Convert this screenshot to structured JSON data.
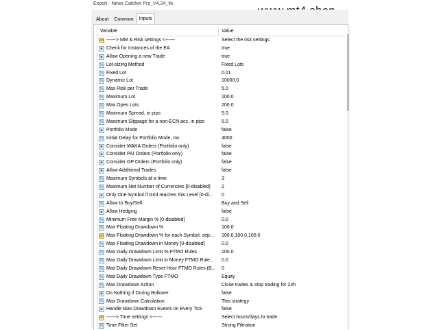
{
  "window": {
    "title": "Expert - News Catcher Pro_V4.24_fix"
  },
  "watermark": "www.mt4.shop",
  "tabs": [
    {
      "label": "About",
      "active": false
    },
    {
      "label": "Common",
      "active": false
    },
    {
      "label": "Inputs",
      "active": true
    }
  ],
  "grid": {
    "headers": {
      "variable": "Variable",
      "value": "Value"
    },
    "rows": [
      {
        "icon": "ab",
        "name": "------> MM & Risk settings <------",
        "value": "Select the risk settings"
      },
      {
        "icon": "bool",
        "name": "Check for Instances of the EA",
        "value": "true"
      },
      {
        "icon": "bool",
        "name": "Allow Opening a new Trade",
        "value": "true"
      },
      {
        "icon": "num",
        "name": "Lot-sizing Method",
        "value": "Fixed Lots"
      },
      {
        "icon": "num",
        "name": "Fixed Lot",
        "value": "0.01"
      },
      {
        "icon": "num",
        "name": "Dynamic Lot",
        "value": "10000.0"
      },
      {
        "icon": "num",
        "name": "Max Risk per Trade",
        "value": "5.0"
      },
      {
        "icon": "num",
        "name": "Maximum Lot",
        "value": "200.0"
      },
      {
        "icon": "num",
        "name": "Max Open Lots",
        "value": "200.0"
      },
      {
        "icon": "num",
        "name": "Maximum Spread, in pips",
        "value": "5.0"
      },
      {
        "icon": "num",
        "name": "Maximum Slippage for a non-ECN acc, in pips",
        "value": "5.0"
      },
      {
        "icon": "bool",
        "name": "Portfolio Mode",
        "value": "false"
      },
      {
        "icon": "num",
        "name": "Initial Delay for Portfolio Mode, ms",
        "value": "4000"
      },
      {
        "icon": "bool",
        "name": "Consider WAKA Orders (Portfolio only)",
        "value": "false"
      },
      {
        "icon": "bool",
        "name": "Consider PAI Orders (Portfolio only)",
        "value": "false"
      },
      {
        "icon": "bool",
        "name": "Consider GP Orders (Portfolio only)",
        "value": "false"
      },
      {
        "icon": "bool",
        "name": "Allow Additional Trades",
        "value": "false"
      },
      {
        "icon": "num",
        "name": "Maximum Symbols at a time",
        "value": "3"
      },
      {
        "icon": "num",
        "name": "Maximum Net Number of Currencies [0-disabled]",
        "value": "2"
      },
      {
        "icon": "bool",
        "name": "Only One Symbol if Grid reaches this Level [0-di...",
        "value": "0"
      },
      {
        "icon": "num",
        "name": "Allow to Buy/Sell",
        "value": "Buy and Sell"
      },
      {
        "icon": "bool",
        "name": "Allow Hedging",
        "value": "false"
      },
      {
        "icon": "num",
        "name": "Minimum Free Margin % [0-disabled]",
        "value": "0.0"
      },
      {
        "icon": "num",
        "name": "Max Floating Drawdown %",
        "value": "100.0"
      },
      {
        "icon": "ab",
        "name": "Max Floating Drawdown % for each Symbol, sep...",
        "value": "100.0,100.0,100.0"
      },
      {
        "icon": "num",
        "name": "Max Floating Drawdown in Money [0-disabled]",
        "value": "0.0"
      },
      {
        "icon": "num",
        "name": "Max Daily Drawdown Limit % FTMO Rules",
        "value": "100.0"
      },
      {
        "icon": "num",
        "name": "Max Daily Drawdown Limit in Money FTMO Rule...",
        "value": "0.0"
      },
      {
        "icon": "num",
        "name": "Max Daily Drawdown Reset Hour FTMO Rules (B...",
        "value": "0"
      },
      {
        "icon": "num",
        "name": "Max Daily Drawdown Type FTMO",
        "value": "Equity"
      },
      {
        "icon": "num",
        "name": "Max Drawdown Action",
        "value": "Close trades & stop trading for 24h"
      },
      {
        "icon": "bool",
        "name": "Do Nothing if During Rollover",
        "value": "false"
      },
      {
        "icon": "num",
        "name": "Max Drawdown Calculation",
        "value": "This strategy"
      },
      {
        "icon": "bool",
        "name": "Handle Max Drawdown Events on Every Tick",
        "value": "false"
      },
      {
        "icon": "ab",
        "name": "------> Time settings <------",
        "value": "Select hours/days to trade"
      },
      {
        "icon": "num",
        "name": "Time Filter Set",
        "value": "Strong Filtration"
      }
    ]
  }
}
